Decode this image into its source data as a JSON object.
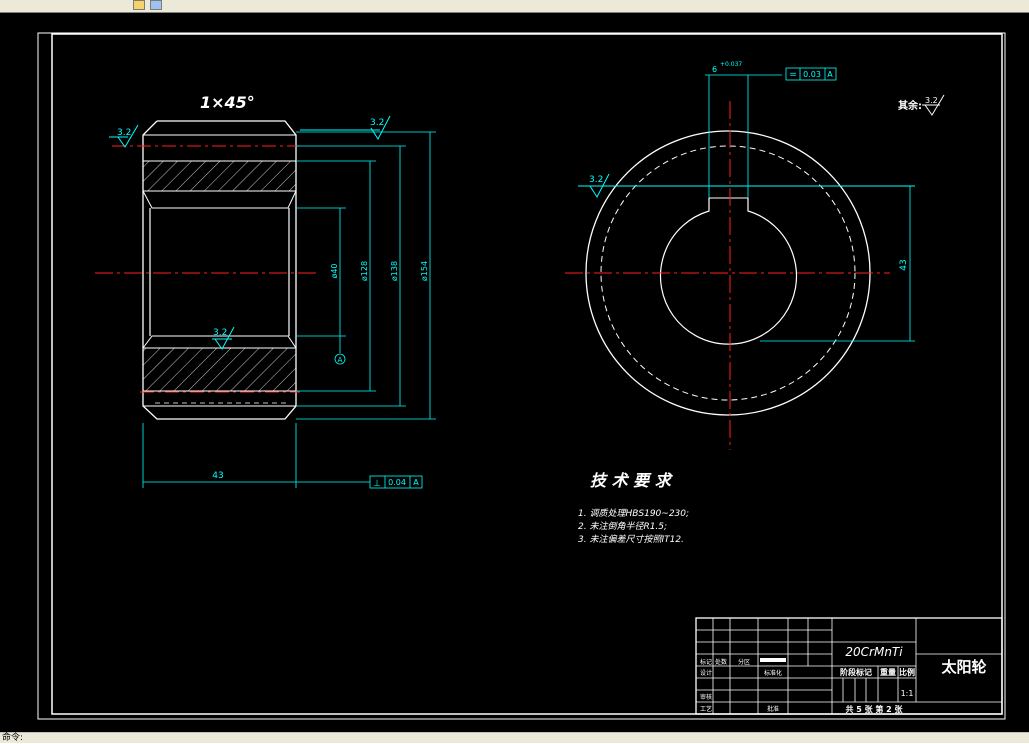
{
  "drawing": {
    "chamfer_label": "1×45°",
    "roughness": {
      "left_top": "3.2",
      "right_top": "3.2",
      "bore": "3.2",
      "keyway": "3.2",
      "other_prefix": "其余:",
      "other_value": "3.2"
    },
    "dims": {
      "width": "43",
      "d_bore": "ø40",
      "d_mid": "ø128",
      "d_root": "ø138",
      "d_tip": "ø154",
      "key_height": "43",
      "key_width": "6",
      "key_tol": "+0.037"
    },
    "datum_label": "A",
    "tolerance_frame_1": {
      "symbol": "⊥",
      "value": "0.04",
      "datum": "A"
    },
    "tolerance_frame_2": {
      "symbol": "=",
      "value": "0.03",
      "datum": "A"
    },
    "tech_req": {
      "title": "技 术 要 求",
      "items": [
        "1. 调质处理HBS190~230;",
        "2. 未注倒角半径R1.5;",
        "3. 未注偏差尺寸按照IT12."
      ]
    },
    "title_block": {
      "material": "20CrMnTi",
      "part_name": "太阳轮",
      "stage_mark": "阶段标记",
      "weight": "重量",
      "scale_label": "比例",
      "scale": "1:1",
      "sheets": "共 5 张  第 2 张",
      "cells": [
        "标记",
        "处数",
        "分区",
        "设计",
        "审核",
        "工艺",
        "标准化",
        "批准"
      ]
    }
  },
  "status": {
    "command_prompt": "命令:"
  }
}
